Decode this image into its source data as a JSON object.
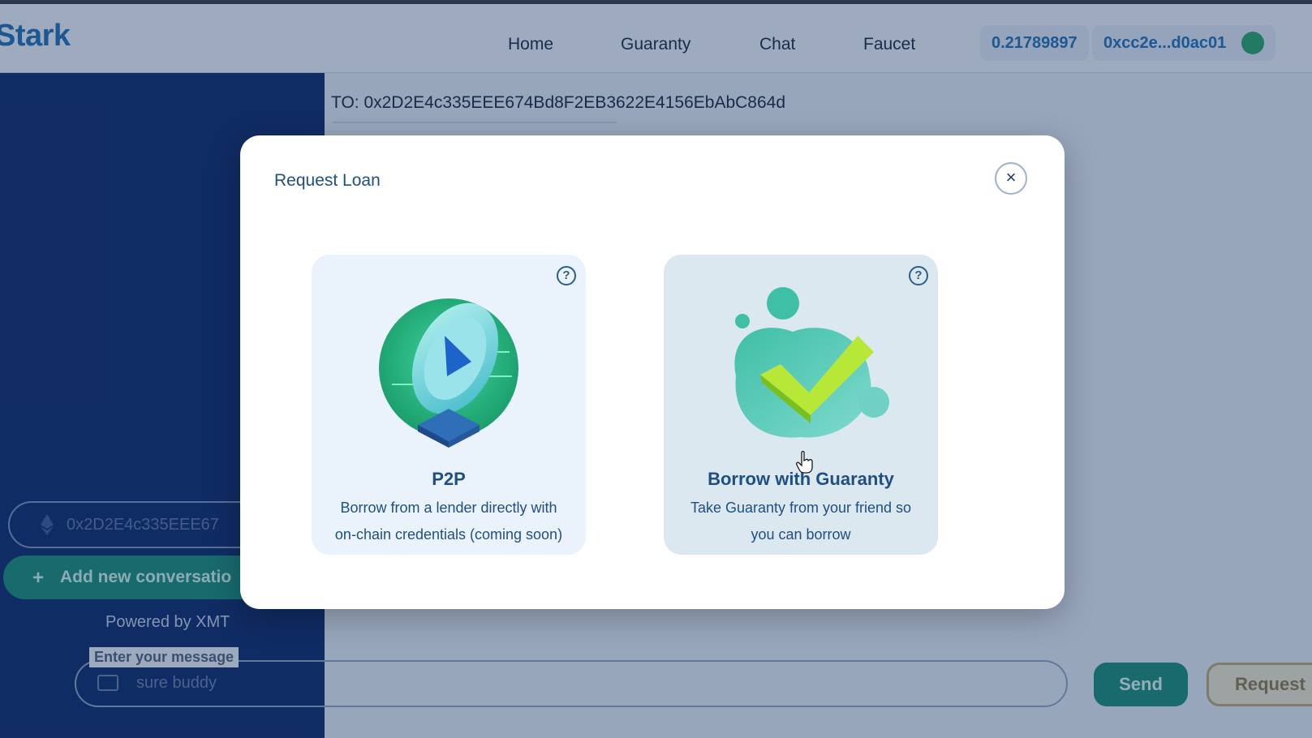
{
  "navbar": {
    "brand": "Stark",
    "links": [
      "Home",
      "Guaranty",
      "Chat",
      "Faucet"
    ],
    "balance": "0.21789897",
    "wallet": "0xcc2e...d0ac01"
  },
  "sidebar": {
    "conversation_address": "0x2D2E4c335EEE67",
    "add_conversation": "Add new conversatio",
    "powered_by": "Powered by XMT"
  },
  "chat": {
    "to_label": "TO: 0x2D2E4c335EEE674Bd8F2EB3622E4156EbAbC864d",
    "message_label": "Enter your message",
    "message_value": "sure buddy",
    "send_label": "Send",
    "request_label": "Request"
  },
  "modal": {
    "title": "Request Loan",
    "close_glyph": "×",
    "cards": [
      {
        "title": "P2P",
        "desc_line1": "Borrow from a lender directly with",
        "desc_line2": "on-chain credentials (coming soon)",
        "icon": "p2p-coin-icon"
      },
      {
        "title": "Borrow with Guaranty",
        "desc_line1": "Take Guaranty from your friend so",
        "desc_line2": "you can borrow",
        "icon": "checkmark-icon"
      }
    ],
    "help_glyph": "?"
  },
  "colors": {
    "accent": "#1f6fb4",
    "sidebar": "#0f2b6b",
    "primary_button": "#1b8b78",
    "text_dark": "#1f4f82"
  }
}
